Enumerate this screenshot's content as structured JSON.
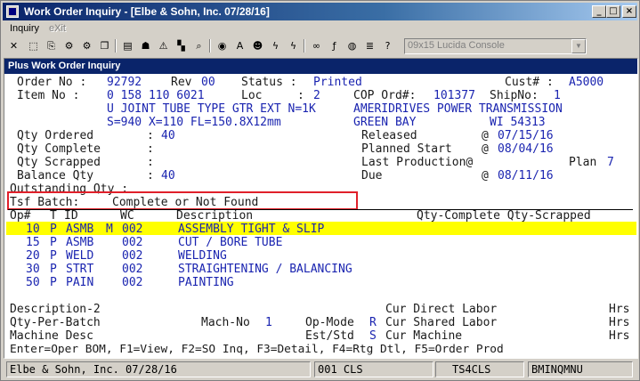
{
  "window": {
    "title": "Work Order Inquiry - [Elbe & Sohn, Inc. 07/28/16]",
    "minimize": "_",
    "maximize": "□",
    "close": "×"
  },
  "menu": {
    "items": [
      {
        "label": "Inquiry"
      },
      {
        "label": "eXit"
      }
    ]
  },
  "toolbar": {
    "font_select": {
      "value": "09x15 Lucida Console",
      "arrow": "▼"
    },
    "buttons": [
      {
        "name": "close-x-icon",
        "glyph": "✕"
      },
      {
        "name": "select-icon",
        "glyph": "⬚"
      },
      {
        "name": "copy-icon",
        "glyph": "⎘"
      },
      {
        "name": "tools-icon",
        "glyph": "⚙"
      },
      {
        "name": "settings-icon",
        "glyph": "⚙"
      },
      {
        "name": "window-icon",
        "glyph": "❐"
      },
      {
        "name": "notes-icon",
        "glyph": "▤"
      },
      {
        "name": "contacts-icon",
        "glyph": "☗"
      },
      {
        "name": "alert-icon",
        "glyph": "⚠"
      },
      {
        "name": "chart-icon",
        "glyph": "▚"
      },
      {
        "name": "search-icon",
        "glyph": "⌕"
      },
      {
        "name": "globe-icon",
        "glyph": "◉"
      },
      {
        "name": "font-icon",
        "glyph": "A"
      },
      {
        "name": "user-icon",
        "glyph": "☻"
      },
      {
        "name": "lightning-icon",
        "glyph": "ϟ"
      },
      {
        "name": "flash-icon",
        "glyph": "ϟ"
      },
      {
        "name": "link-icon",
        "glyph": "∞"
      },
      {
        "name": "function-icon",
        "glyph": "ƒ"
      },
      {
        "name": "record-icon",
        "glyph": "◍"
      },
      {
        "name": "list-icon",
        "glyph": "≣"
      },
      {
        "name": "help-icon",
        "glyph": "?"
      }
    ]
  },
  "panel": {
    "header": "Plus Work Order Inquiry"
  },
  "order": {
    "order_no_label": "Order No :",
    "order_no": "92792",
    "rev_label": "Rev",
    "rev": "00",
    "status_label": "Status :",
    "status": "Printed",
    "cust_label": "Cust# :",
    "cust": "A5000",
    "item_no_label": "Item No :",
    "item_no": "0 158 110 6021",
    "loc_label": "Loc",
    "loc_sep": ":",
    "loc": "2",
    "cop_label": "COP Ord#:",
    "cop": "101377",
    "shipno_label": "ShipNo:",
    "shipno": "1",
    "desc_line1": "U JOINT TUBE TYPE GTR EXT N=1K",
    "desc_line2": "S=940 X=110 FL=150.8X12mm",
    "customer_name": "AMERIDRIVES POWER TRANSMISSION",
    "customer_city": "GREEN BAY",
    "customer_state_zip": "WI 54313"
  },
  "quantities": {
    "ordered_label": "Qty Ordered",
    "ordered": "40",
    "complete_label": "Qty Complete",
    "scrapped_label": "Qty Scrapped",
    "balance_label": "Balance Qty",
    "balance": "40",
    "outstanding_label": "Outstanding Qty :",
    "colon": ":"
  },
  "dates": {
    "released_label": "Released",
    "released": "07/15/16",
    "planned_start_label": "Planned Start",
    "planned_start": "08/04/16",
    "last_production_label": "Last Production@",
    "plan_label": "Plan",
    "plan": "7",
    "due_label": "Due",
    "due": "08/11/16",
    "at": "@"
  },
  "tsf_batch": {
    "label": "Tsf Batch:",
    "value": "Complete or Not Found"
  },
  "ops_table": {
    "headers": {
      "op": "Op#",
      "t": "T",
      "id": "ID",
      "wc": "WC",
      "description": "Description",
      "qty": "Qty-Complete Qty-Scrapped"
    },
    "rows": [
      {
        "op": "10",
        "t": "P",
        "id": "ASMB",
        "flag": "M",
        "wc": "002",
        "description": "ASSEMBLY TIGHT & SLIP",
        "selected": true
      },
      {
        "op": "15",
        "t": "P",
        "id": "ASMB",
        "flag": "",
        "wc": "002",
        "description": "CUT / BORE TUBE",
        "selected": false
      },
      {
        "op": "20",
        "t": "P",
        "id": "WELD",
        "flag": "",
        "wc": "002",
        "description": "WELDING",
        "selected": false
      },
      {
        "op": "30",
        "t": "P",
        "id": "STRT",
        "flag": "",
        "wc": "002",
        "description": "STRAIGHTENING / BALANCING",
        "selected": false
      },
      {
        "op": "50",
        "t": "P",
        "id": "PAIN",
        "flag": "",
        "wc": "002",
        "description": "PAINTING",
        "selected": false
      }
    ]
  },
  "details": {
    "description2_label": "Description-2",
    "qty_per_batch_label": "Qty-Per-Batch",
    "mach_no_label": "Mach-No",
    "mach_no": "1",
    "op_mode_label": "Op-Mode",
    "op_mode": "R",
    "machine_desc_label": "Machine Desc",
    "est_std_label": "Est/Std",
    "est_std": "S",
    "cur_direct_label": "Cur Direct Labor",
    "cur_shared_label": "Cur Shared Labor",
    "cur_machine_label": "Cur Machine",
    "hrs": "Hrs"
  },
  "help_line": "Enter=Oper BOM, F1=View, F2=SO Inq, F3=Detail, F4=Rtg Dtl, F5=Order Prod",
  "statusbar": {
    "company": "Elbe & Sohn, Inc. 07/28/16",
    "cls": "001 CLS",
    "terminal": "TS4CLS",
    "program": "BMINQMNU"
  }
}
